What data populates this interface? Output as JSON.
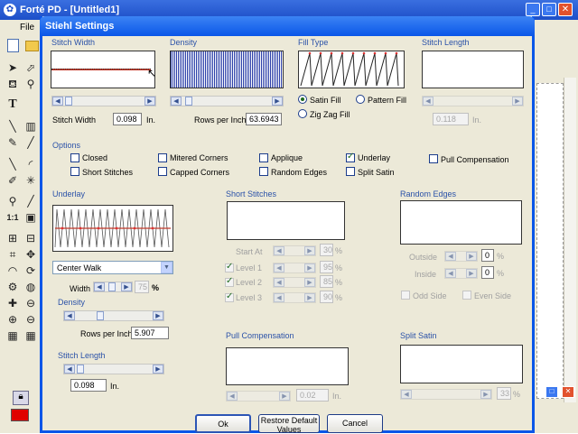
{
  "app": {
    "title": "Forté PD - [Untitled1]",
    "menu_file": "File",
    "toolbar_icons": [
      "new-file-icon",
      "open-folder-icon",
      "select-arrow-icon",
      "node-select-icon",
      "fill-bucket-icon",
      "dropper-icon",
      "text-icon",
      "line-icon",
      "column-icon",
      "stitch-icon",
      "needle-icon",
      "curve-icon",
      "arc-icon",
      "pen-icon",
      "sparkle-icon",
      "zoom-icon",
      "measure-icon",
      "zoom-1to1-icon",
      "zoom-fit-icon",
      "grid-icon",
      "align-icon",
      "crop-icon",
      "move-icon",
      "fan-icon",
      "rotate-icon",
      "gear-icon",
      "globe-icon",
      "puzzle-icon",
      "target-icon",
      "stack-icon",
      "stack2-icon",
      "stack3-icon",
      "stack4-icon"
    ],
    "lock_icon": "lock-icon",
    "color_swatch": "#e00000",
    "window_controls": [
      "minimize-icon",
      "maximize-icon",
      "close-icon"
    ]
  },
  "dialog": {
    "title": "Stiehl Settings",
    "stitch_width": {
      "label": "Stitch Width",
      "field_label": "Stitch Width",
      "value": "0.098",
      "unit": "In."
    },
    "density": {
      "label": "Density",
      "field_label": "Rows per Inch",
      "value": "63.6943"
    },
    "fill_type": {
      "label": "Fill Type",
      "satin": "Satin Fill",
      "pattern": "Pattern Fill",
      "zigzag": "Zig Zag Fill",
      "selected": "Satin Fill"
    },
    "stitch_length": {
      "label": "Stitch Length",
      "value": "0.118",
      "unit": "In."
    },
    "options": {
      "label": "Options",
      "items": [
        {
          "label": "Closed",
          "checked": false
        },
        {
          "label": "Short Stitches",
          "checked": false
        },
        {
          "label": "Mitered Corners",
          "checked": false
        },
        {
          "label": "Capped Corners",
          "checked": false
        },
        {
          "label": "Applique",
          "checked": false
        },
        {
          "label": "Random Edges",
          "checked": false
        },
        {
          "label": "Underlay",
          "checked": true
        },
        {
          "label": "Split Satin",
          "checked": false
        },
        {
          "label": "Pull Compensation",
          "checked": false
        }
      ]
    },
    "underlay": {
      "label": "Underlay",
      "type": "Center Walk",
      "width_label": "Width",
      "width_value": "75",
      "width_unit": "%",
      "density_label": "Density",
      "rows_label": "Rows per Inch",
      "rows_value": "5.907",
      "length_label": "Stitch Length",
      "length_value": "0.098",
      "length_unit": "In."
    },
    "short_stitches": {
      "label": "Short Stitches",
      "start_label": "Start At",
      "start_value": "30",
      "levels": [
        {
          "label": "Level 1",
          "value": "95"
        },
        {
          "label": "Level 2",
          "value": "85"
        },
        {
          "label": "Level 3",
          "value": "90"
        }
      ],
      "unit": "%"
    },
    "random_edges": {
      "label": "Random Edges",
      "outside_label": "Outside",
      "outside_value": "0",
      "inside_label": "Inside",
      "inside_value": "0",
      "unit": "%",
      "odd_side": "Odd Side",
      "even_side": "Even Side"
    },
    "pull_compensation": {
      "label": "Pull Compensation",
      "value": "0.02",
      "unit": "In."
    },
    "split_satin": {
      "label": "Split Satin",
      "value": "33",
      "unit": "%"
    },
    "buttons": {
      "ok": "Ok",
      "restore": "Restore Default Values",
      "cancel": "Cancel"
    }
  }
}
